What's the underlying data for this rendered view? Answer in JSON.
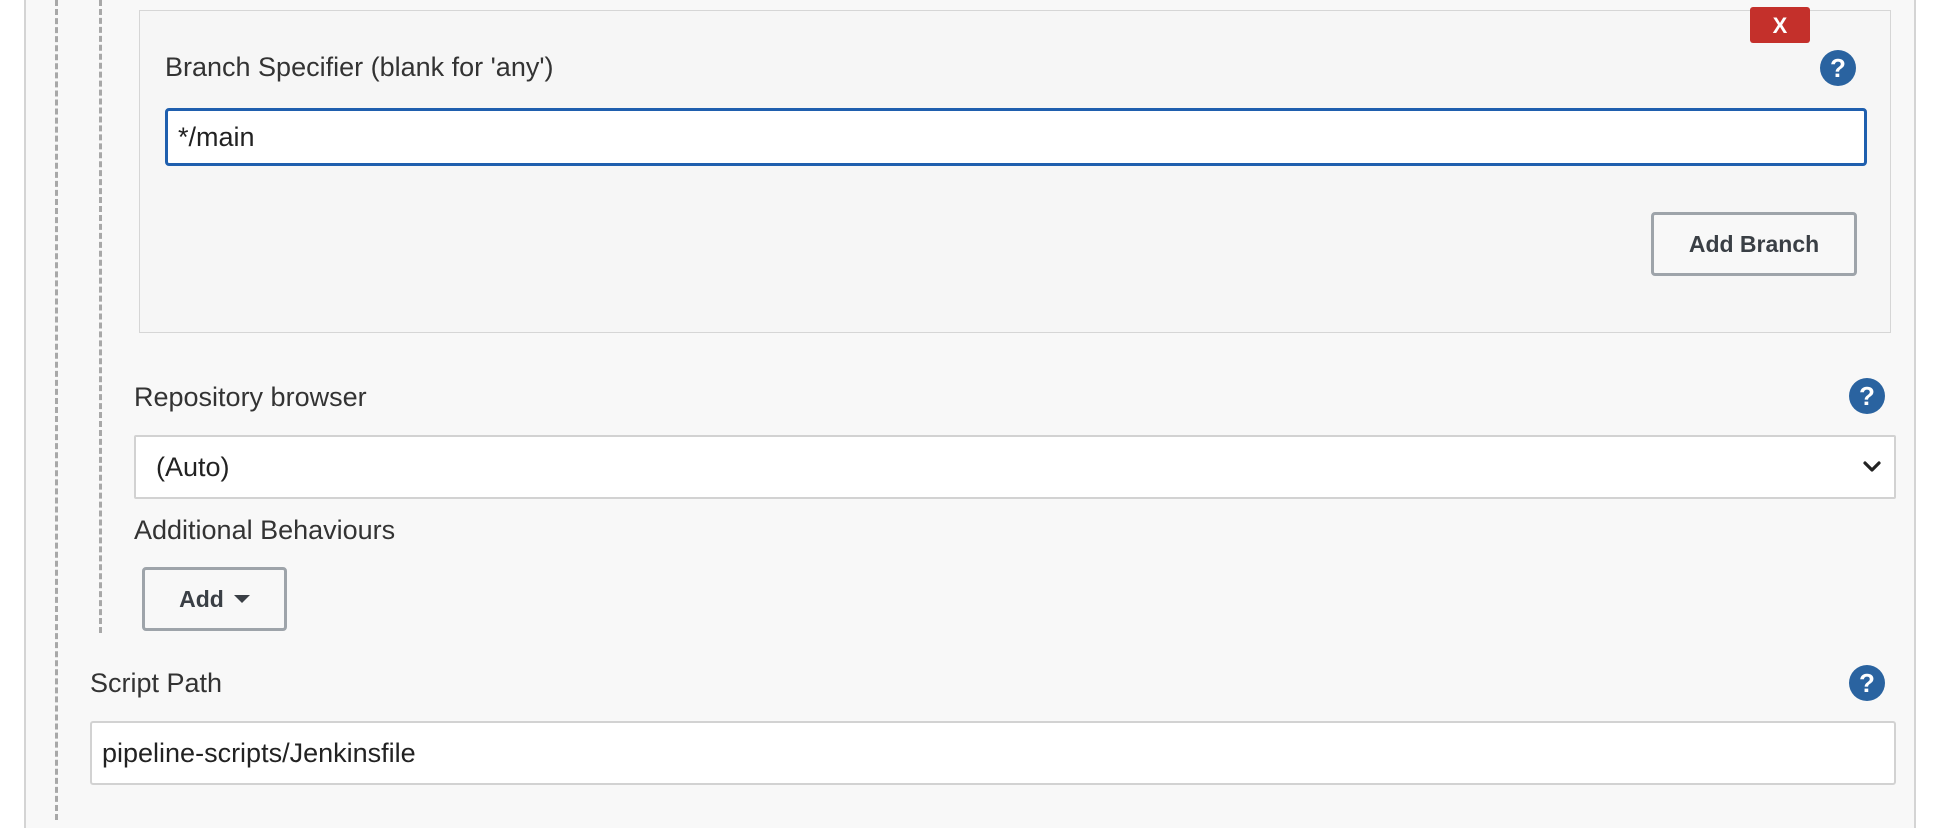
{
  "branch_section": {
    "delete_label": "X",
    "specifier_label": "Branch Specifier (blank for 'any')",
    "specifier_value": "*/main",
    "help_label": "?",
    "add_branch_label": "Add Branch"
  },
  "repository_browser": {
    "label": "Repository browser",
    "selected": "(Auto)",
    "help_label": "?"
  },
  "additional_behaviours": {
    "label": "Additional Behaviours",
    "add_label": "Add"
  },
  "script_path": {
    "label": "Script Path",
    "value": "pipeline-scripts/Jenkinsfile",
    "help_label": "?"
  },
  "colors": {
    "delete_button": "#c4302b",
    "help_icon": "#2a63a0",
    "focus_border": "#1f5fae"
  },
  "icons": {
    "help": "question-circle",
    "dropdown": "chevron-down",
    "add_menu": "caret-down"
  }
}
